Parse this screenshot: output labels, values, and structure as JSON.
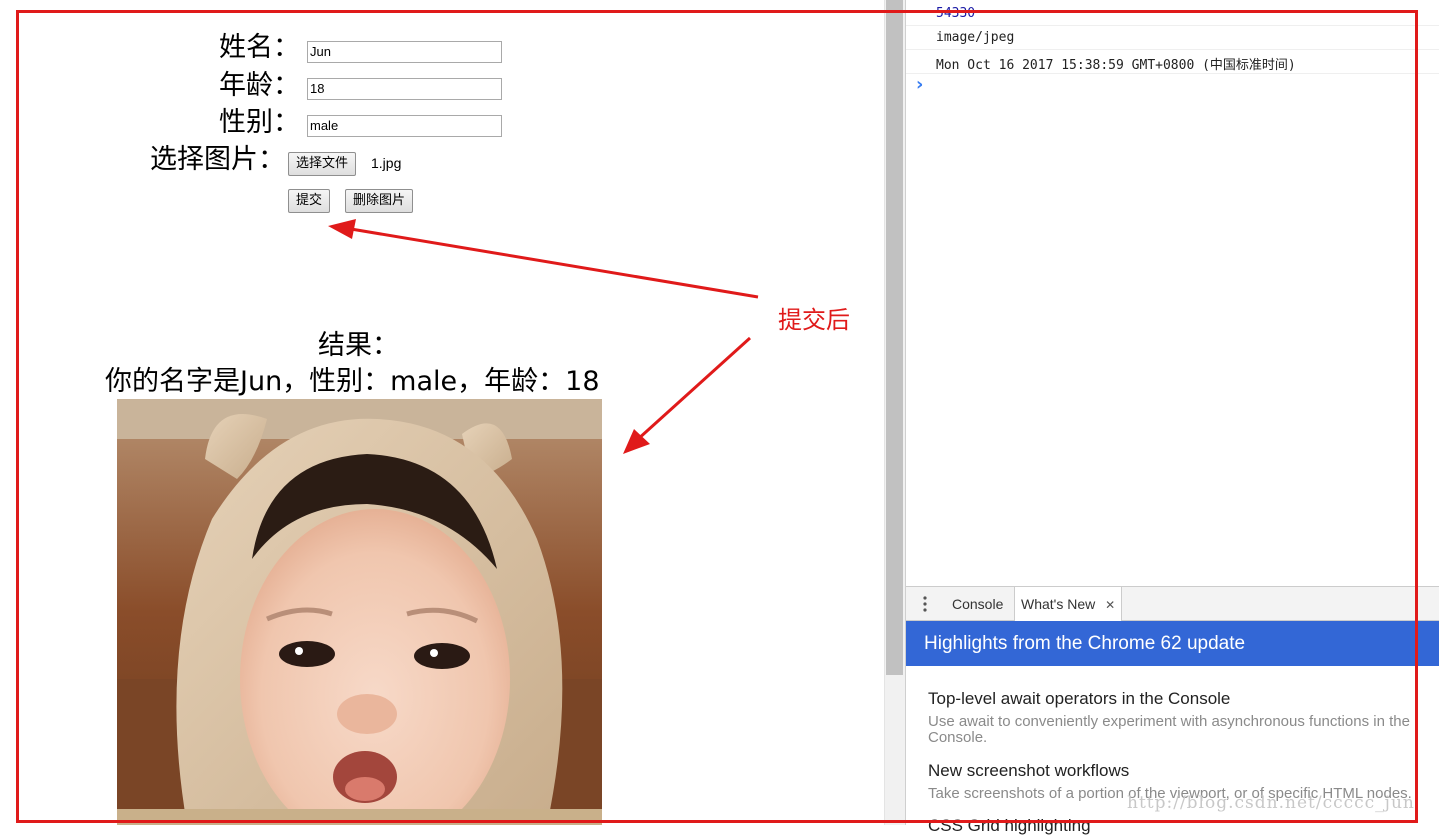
{
  "form": {
    "name_label": "姓名：",
    "name_value": "Jun",
    "age_label": "年龄：",
    "age_value": "18",
    "gender_label": "性别：",
    "gender_value": "male",
    "image_label": "选择图片：",
    "choose_file_button": "选择文件",
    "file_name": "1.jpg",
    "submit_button": "提交",
    "delete_image_button": "删除图片"
  },
  "result": {
    "title": "结果：",
    "text": "你的名字是Jun，性别：male，年龄：18"
  },
  "annotation": {
    "label": "提交后",
    "color": "#e01a1a"
  },
  "devtools": {
    "console_lines": [
      "54330",
      "image/jpeg",
      "Mon Oct 16 2017 15:38:59 GMT+0800 (中国标准时间)"
    ],
    "prompt_symbol": "›",
    "drawer_tabs": [
      {
        "label": "Console",
        "active": false
      },
      {
        "label": "What's New",
        "active": true
      }
    ],
    "close_symbol": "✕",
    "highlights_title": "Highlights from the Chrome 62 update",
    "highlight_color": "#3367d6",
    "features": [
      {
        "title": "Top-level await operators in the Console",
        "desc": "Use await to conveniently experiment with asynchronous functions in the Console."
      },
      {
        "title": "New screenshot workflows",
        "desc": "Take screenshots of a portion of the viewport, or of specific HTML nodes."
      },
      {
        "title": "CSS Grid highlighting",
        "desc": ""
      }
    ]
  },
  "watermark": "http://blog.csdn.net/ccccc_jun"
}
